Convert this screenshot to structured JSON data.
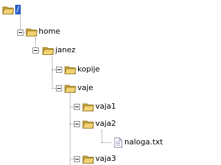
{
  "tree": {
    "root": {
      "label": "/",
      "icon": "open-folder-icon"
    },
    "nodes": [
      {
        "label": "home",
        "icon": "folder-icon"
      },
      {
        "label": "janez",
        "icon": "folder-icon"
      },
      {
        "label": "kopije",
        "icon": "folder-icon"
      },
      {
        "label": "vaje",
        "icon": "folder-icon"
      },
      {
        "label": "vaja1",
        "icon": "folder-icon"
      },
      {
        "label": "vaja2",
        "icon": "folder-icon"
      },
      {
        "label": "naloga.txt",
        "icon": "text-file-icon"
      },
      {
        "label": "vaja3",
        "icon": "folder-icon"
      }
    ],
    "selection_color": "#2a5fc7",
    "folder_color": "#e8c45a"
  }
}
